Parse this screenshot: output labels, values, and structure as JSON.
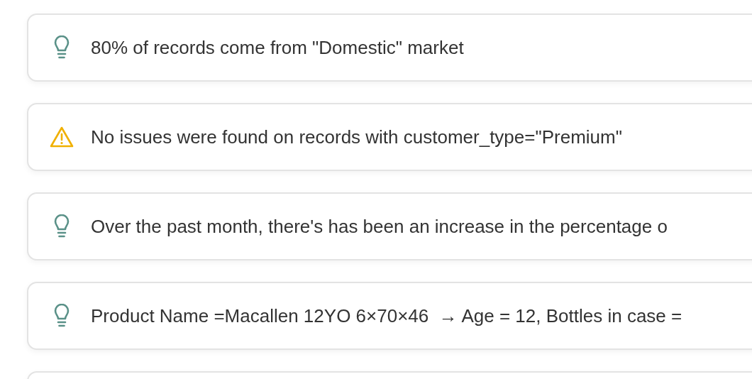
{
  "insights": [
    {
      "kind": "insight",
      "text": "80% of records come from \"Domestic\" market"
    },
    {
      "kind": "warning",
      "text": "No issues were found on records with customer_type=\"Premium\""
    },
    {
      "kind": "insight",
      "text": "Over the past month, there's has been an increase in the percentage o"
    },
    {
      "kind": "insight",
      "text": "Product Name =Macallen 12YO 6×70×46  → Age = 12, Bottles in case ="
    },
    {
      "kind": "empty"
    }
  ]
}
